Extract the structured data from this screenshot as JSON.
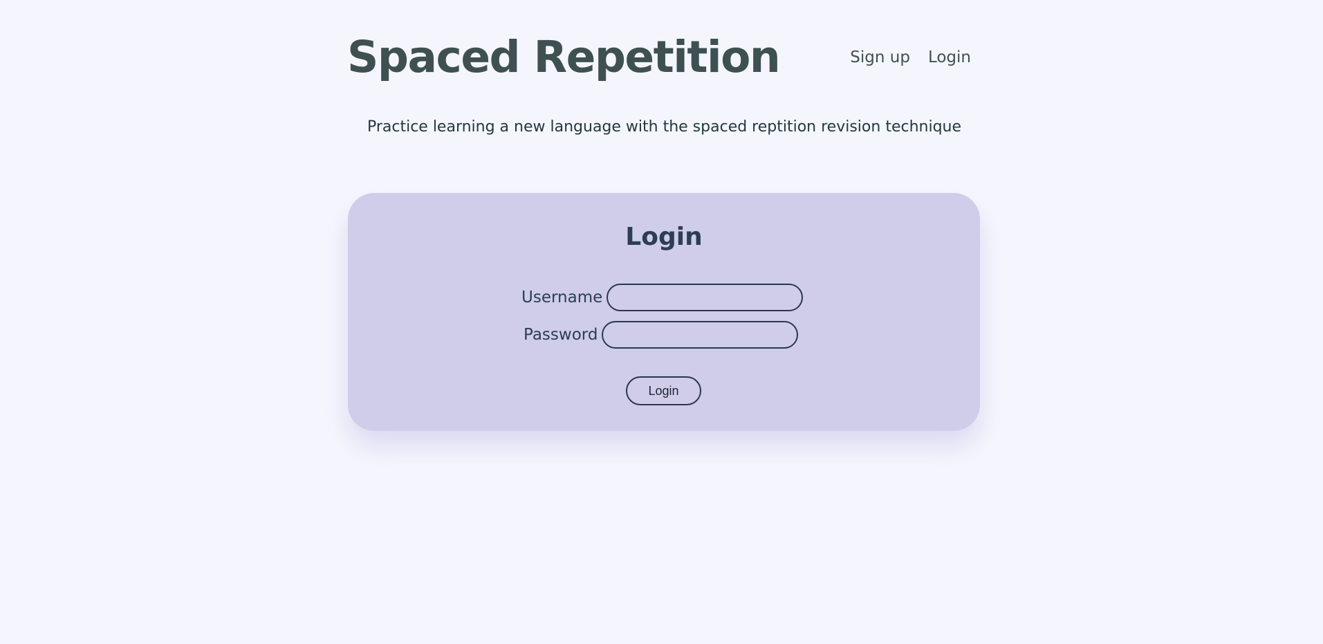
{
  "header": {
    "title": "Spaced Repetition",
    "nav": {
      "signup_label": "Sign up",
      "login_label": "Login"
    }
  },
  "subtitle": "Practice learning a new language with the spaced reptition revision technique",
  "login_form": {
    "title": "Login",
    "username": {
      "label": "Username",
      "value": ""
    },
    "password": {
      "label": "Password",
      "value": ""
    },
    "submit_label": "Login"
  },
  "colors": {
    "page_background": "#f5f6fd",
    "card_background": "#cfcdea",
    "title_text": "#3f5052",
    "body_text": "#2c3e50",
    "input_border": "#2c3550"
  }
}
